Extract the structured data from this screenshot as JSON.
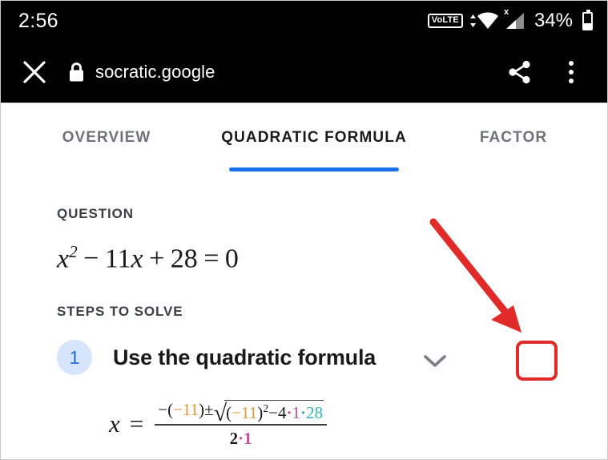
{
  "status_bar": {
    "time": "2:56",
    "volte_label": "VoLTE",
    "wifi_icon": "wifi-icon",
    "cellular_icon": "cellular-signal-icon",
    "cellular_badge": "x",
    "battery_percent": "34%",
    "battery_icon": "battery-icon"
  },
  "toolbar": {
    "close_icon": "close-icon",
    "lock_icon": "lock-icon",
    "origin": "socratic.google",
    "share_icon": "share-icon",
    "more_icon": "overflow-menu-icon"
  },
  "tabs": {
    "items": [
      {
        "label": "OVERVIEW",
        "active": false
      },
      {
        "label": "QUADRATIC FORMULA",
        "active": true
      },
      {
        "label": "FACTOR",
        "active": false
      }
    ],
    "active_index": 1,
    "indicator_color": "#1a73e8"
  },
  "content": {
    "question_label": "QUESTION",
    "question_equation": {
      "var": "x",
      "exponent": "2",
      "op1": "−",
      "term2": "11",
      "var2": "x",
      "op2": "+",
      "term3": "28",
      "equals": "=",
      "rhs": "0",
      "plain": "x² − 11x + 28 = 0"
    },
    "steps_label": "STEPS TO SOLVE",
    "steps": [
      {
        "number": "1",
        "title": "Use the quadratic formula",
        "expanded": false,
        "toggle_icon": "chevron-down-icon",
        "badge_bg": "#d6e5fb",
        "badge_fg": "#1f6fdd"
      }
    ],
    "formula": {
      "lhs_var": "x",
      "equals": "=",
      "numerator": {
        "neg": "−",
        "open": "(",
        "b_value": "−11",
        "close": ")",
        "plusminus": "±",
        "radical_icon": "square-root-icon",
        "rad_open": "(",
        "rad_b": "−11",
        "rad_close": ")",
        "power": "2",
        "minus": "−",
        "four": "4",
        "dot": "·",
        "a_value": "1",
        "c_value": "28"
      },
      "denominator": {
        "two": "2",
        "dot": "·",
        "a_value": "1"
      },
      "plain": "x = ( −(−11) ± √((−11)² − 4·1·28) ) / (2·1)",
      "colors": {
        "b_coefficient": "#d99a3a",
        "a_coefficient": "#c84e9b",
        "c_constant": "#38b0bf",
        "default": "#1a1a1a"
      }
    }
  },
  "annotation": {
    "arrow_icon": "red-arrow-annotation",
    "arrow_color": "#e02b28",
    "highlight_icon": "red-highlight-box",
    "highlight_color": "#e02b28",
    "target": "chevron-down-icon"
  }
}
